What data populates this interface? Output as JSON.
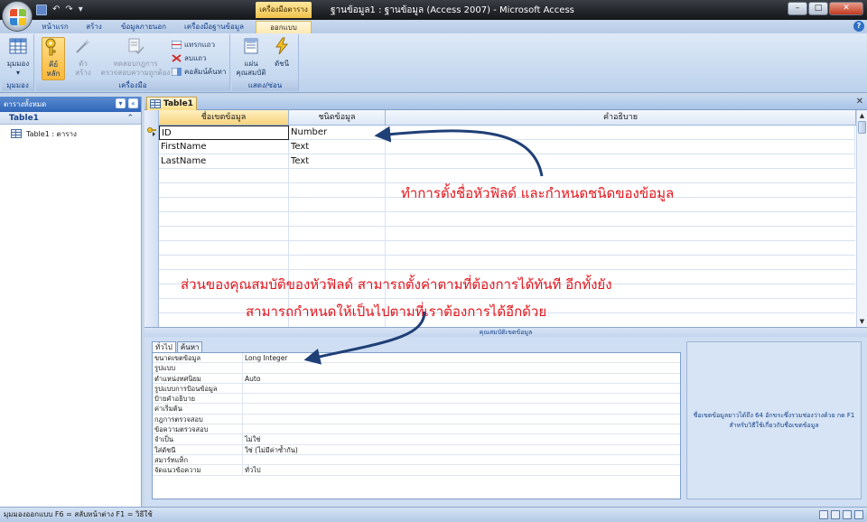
{
  "window": {
    "title": "ฐานข้อมูล1 : ฐานข้อมูล (Access 2007) - Microsoft Access",
    "context_tab": "เครื่องมือตาราง",
    "controls": [
      "–",
      "□",
      "✕"
    ]
  },
  "qat": {
    "undo": "↶",
    "redo": "↷",
    "customize": "▾"
  },
  "ribbon_tabs": [
    {
      "label": "หน้าแรก"
    },
    {
      "label": "สร้าง"
    },
    {
      "label": "ข้อมูลภายนอก"
    },
    {
      "label": "เครื่องมือฐานข้อมูล"
    },
    {
      "label": "ออกแบบ",
      "active": true
    }
  ],
  "ribbon": {
    "groups": {
      "views": {
        "label": "มุมมอง",
        "view_button": "มุมมอง"
      },
      "tools": {
        "label": "เครื่องมือ",
        "primary_key": "คีย์\nหลัก",
        "builder": "ตัว\nสร้าง",
        "test_rules": "ทดสอบกฎการ\nตรวจสอบความถูกต้อง",
        "insert_rows": "แทรกแถว",
        "delete_rows": "ลบแถว",
        "lookup_column": "คอลัมน์ค้นหา"
      },
      "show_hide": {
        "label": "แสดง/ซ่อน",
        "property_sheet": "แผ่น\nคุณสมบัติ",
        "indexes": "ดัชนี"
      }
    }
  },
  "nav_pane": {
    "header": "ตารางทั้งหมด",
    "group": "Table1",
    "items": [
      {
        "label": "Table1 : ตาราง"
      }
    ]
  },
  "document": {
    "tab_label": "Table1",
    "close": "✕",
    "columns": [
      "ชื่อเขตข้อมูล",
      "ชนิดข้อมูล",
      "คำอธิบาย"
    ],
    "rows": [
      {
        "field": "ID",
        "type": "Number",
        "desc": ""
      },
      {
        "field": "FirstName",
        "type": "Text",
        "desc": ""
      },
      {
        "field": "LastName",
        "type": "Text",
        "desc": ""
      }
    ]
  },
  "field_properties": {
    "title": "คุณสมบัติเขตข้อมูล",
    "tabs": [
      "ทั่วไป",
      "ค้นหา"
    ],
    "rows": [
      {
        "name": "ขนาดเขตข้อมูล",
        "value": "Long Integer"
      },
      {
        "name": "รูปแบบ",
        "value": ""
      },
      {
        "name": "ตำแหน่งทศนิยม",
        "value": "Auto"
      },
      {
        "name": "รูปแบบการป้อนข้อมูล",
        "value": ""
      },
      {
        "name": "ป้ายคำอธิบาย",
        "value": ""
      },
      {
        "name": "ค่าเริ่มต้น",
        "value": ""
      },
      {
        "name": "กฎการตรวจสอบ",
        "value": ""
      },
      {
        "name": "ข้อความตรวจสอบ",
        "value": ""
      },
      {
        "name": "จำเป็น",
        "value": "ไม่ใช่"
      },
      {
        "name": "ใส่ดัชนี",
        "value": "ใช่ (ไม่มีค่าซ้ำกัน)"
      },
      {
        "name": "สมาร์ทแท็ก",
        "value": ""
      },
      {
        "name": "จัดแนวข้อความ",
        "value": "ทั่วไป"
      }
    ],
    "hint": "ชื่อเขตข้อมูลยาวได้ถึง 64 อักขระซึ่งรวมช่องว่างด้วย กด F1 สำหรับวิธีใช้เกี่ยวกับชื่อเขตข้อมูล"
  },
  "status_bar": {
    "text": "มุมมองออกแบบ  F6 = สลับหน้าต่าง  F1 = วิธีใช้"
  },
  "annotations": {
    "note1": "ทำการตั้งชื่อหัวฟิลด์ และกำหนดชนิดของข้อมูล",
    "note2_line1": "ส่วนของคุณสมบัติของหัวฟิลด์ สามารถตั้งค่าตามที่ต้องการได้ทันที อีกทั้งยัง",
    "note2_line2": "สามารถกำหนดให้เป็นไปตามที่เราต้องการได้อีกด้วย",
    "color": "#e2141a"
  },
  "colors": {
    "accent": "#15428b",
    "active_tab": "#fde9b0",
    "arrow": "#1f3f77"
  }
}
